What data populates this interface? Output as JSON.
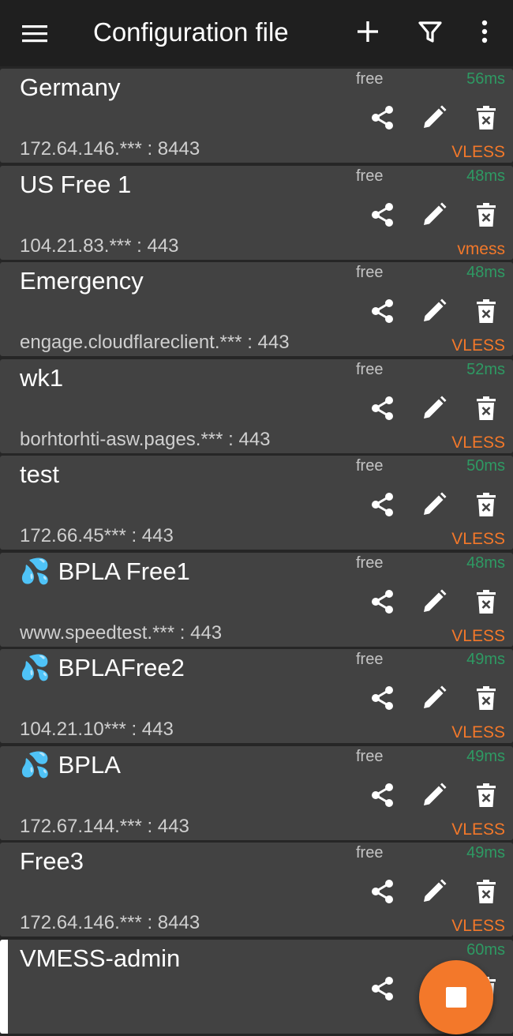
{
  "appbar": {
    "title": "Configuration file",
    "icons": [
      "menu-icon",
      "plus-icon",
      "filter-icon",
      "more-vert-icon"
    ]
  },
  "colors": {
    "background": "#262626",
    "appbar": "#1f1f1f",
    "card": "#424242",
    "latency": "#2e9a63",
    "protocol": "#f3782a",
    "fab": "#f3782a"
  },
  "servers": [
    {
      "name": "Germany",
      "sub": "free",
      "latency": "56ms",
      "address": "172.64.146.*** : 8443",
      "protocol": "VLESS"
    },
    {
      "name": "US Free 1",
      "sub": "free",
      "latency": "48ms",
      "address": "104.21.83.*** : 443",
      "protocol": "vmess"
    },
    {
      "name": "Emergency",
      "sub": "free",
      "latency": "48ms",
      "address": "engage.cloudflareclient.*** : 443",
      "protocol": "VLESS"
    },
    {
      "name": "wk1",
      "sub": "free",
      "latency": "52ms",
      "address": "borhtorhti-asw.pages.*** : 443",
      "protocol": "VLESS"
    },
    {
      "name": "test",
      "sub": "free",
      "latency": "50ms",
      "address": "172.66.45*** : 443",
      "protocol": "VLESS"
    },
    {
      "name": "BPLA Free1",
      "sub": "free",
      "latency": "48ms",
      "address": "www.speedtest.*** : 443",
      "protocol": "VLESS",
      "emoji": "💦"
    },
    {
      "name": "BPLAFree2",
      "sub": "free",
      "latency": "49ms",
      "address": "104.21.10*** : 443",
      "protocol": "VLESS",
      "emoji": "💦"
    },
    {
      "name": "BPLA",
      "sub": "free",
      "latency": "49ms",
      "address": "172.67.144.*** : 443",
      "protocol": "VLESS",
      "emoji": "💦"
    },
    {
      "name": "Free3",
      "sub": "free",
      "latency": "49ms",
      "address": "172.64.146.*** : 8443",
      "protocol": "VLESS"
    },
    {
      "name": "VMESS-admin",
      "sub": "",
      "latency": "60ms",
      "address": "",
      "protocol": "",
      "selected": true
    }
  ],
  "fab": {
    "icon": "stop-icon",
    "state": "connected"
  }
}
